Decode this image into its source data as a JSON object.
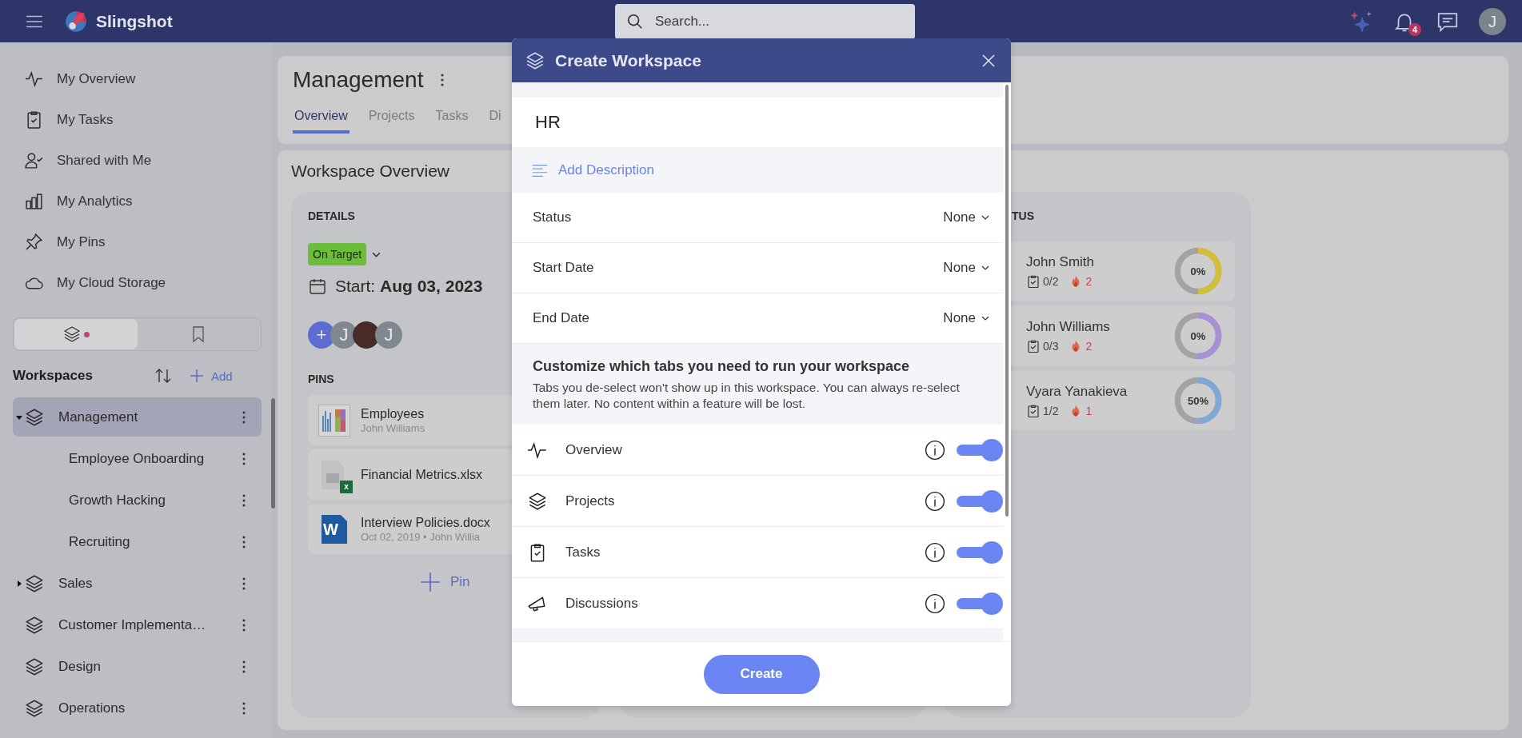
{
  "topbar": {
    "app_name": "Slingshot",
    "search": {
      "placeholder": "Search..."
    },
    "notification_count": "4",
    "avatar_initial": "J"
  },
  "sidebar": {
    "nav": [
      {
        "label": "My Overview"
      },
      {
        "label": "My Tasks"
      },
      {
        "label": "Shared with Me"
      },
      {
        "label": "My Analytics"
      },
      {
        "label": "My Pins"
      },
      {
        "label": "My Cloud Storage"
      }
    ],
    "view_toggle": [
      {
        "selected": true,
        "dot": true
      },
      {
        "selected": false,
        "dot": false
      }
    ],
    "workspaces": {
      "title": "Workspaces",
      "add_label": "Add",
      "items": [
        {
          "label": "Management",
          "selected": true,
          "kind": "parent",
          "expanded": true,
          "children": [
            {
              "label": "Employee Onboarding",
              "selected": false
            },
            {
              "label": "Growth Hacking",
              "selected": false
            },
            {
              "label": "Recruiting",
              "selected": false
            }
          ]
        },
        {
          "label": "Sales",
          "selected": false,
          "kind": "parent",
          "expanded": false
        },
        {
          "label": "Customer Implementa…",
          "selected": false,
          "kind": "leaf"
        },
        {
          "label": "Design",
          "selected": false,
          "kind": "leaf"
        },
        {
          "label": "Operations",
          "selected": false,
          "kind": "leaf"
        }
      ]
    }
  },
  "page": {
    "title": "Management",
    "tabs": [
      {
        "label": "Overview",
        "selected": true
      },
      {
        "label": "Projects",
        "selected": false
      },
      {
        "label": "Tasks",
        "selected": false
      },
      {
        "label": "Di",
        "selected": false
      }
    ],
    "overview": {
      "title": "Workspace Overview",
      "details": {
        "heading": "DETAILS",
        "status": "On Target",
        "start_label": "Start:",
        "start_date": "Aug 03, 2023",
        "avatars": [
          {
            "kind": "add",
            "text": "+"
          },
          {
            "kind": "initial",
            "text": "J"
          },
          {
            "kind": "photo"
          },
          {
            "kind": "initial",
            "text": "J"
          }
        ],
        "pins_heading": "PINS",
        "pins": [
          {
            "kind": "report",
            "title": "Employees",
            "subtitle": "John Williams"
          },
          {
            "kind": "excel",
            "title": "Financial Metrics.xlsx",
            "badge": "x"
          },
          {
            "kind": "word",
            "title": "Interview Policies.docx",
            "subtitle": "Oct 02, 2019 • John Willia",
            "badge": "W"
          }
        ],
        "pin_button": "Pin"
      },
      "status": {
        "heading": "TUS",
        "members": [
          {
            "name": "John Smith",
            "tasks": "0/2",
            "overdue": "2",
            "percent": "0%",
            "color": "#d1bf3a"
          },
          {
            "name": "John Williams",
            "tasks": "0/3",
            "overdue": "2",
            "percent": "0%",
            "color": "#a790d4"
          },
          {
            "name": "Vyara Yanakieva",
            "tasks": "1/2",
            "overdue": "1",
            "percent": "50%",
            "color": "#7fa8d4"
          }
        ]
      }
    }
  },
  "modal": {
    "title": "Create Workspace",
    "name_value": "HR",
    "add_description": "Add Description",
    "fields": [
      {
        "label": "Status",
        "value": "None"
      },
      {
        "label": "Start Date",
        "value": "None"
      },
      {
        "label": "End Date",
        "value": "None"
      }
    ],
    "customize": {
      "heading": "Customize which tabs you need to run your workspace",
      "text": "Tabs you de-select won't show up in this workspace. You can always re-select them later. No content within a feature will be lost."
    },
    "tabs": [
      {
        "label": "Overview",
        "on": true
      },
      {
        "label": "Projects",
        "on": true
      },
      {
        "label": "Tasks",
        "on": true
      },
      {
        "label": "Discussions",
        "on": true
      }
    ],
    "create_button": "Create"
  }
}
